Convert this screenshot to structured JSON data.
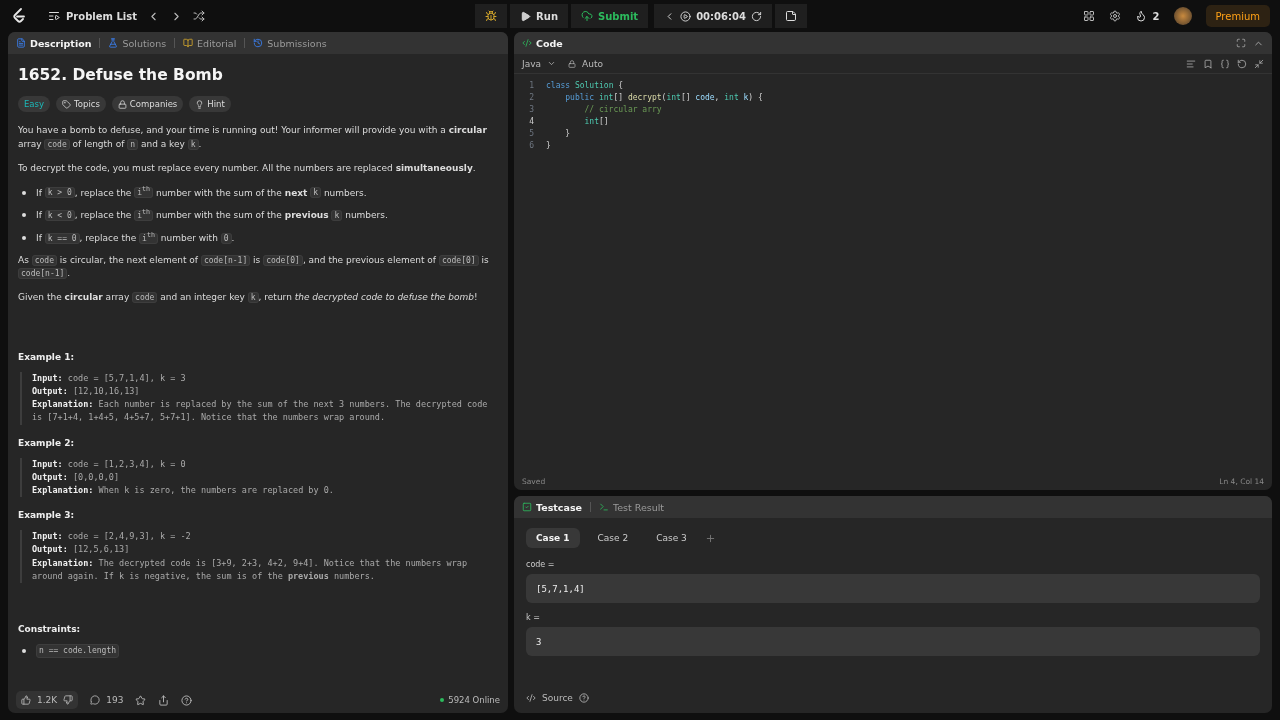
{
  "topbar": {
    "problem_list": "Problem List",
    "run": "Run",
    "submit": "Submit",
    "timer": "00:06:04",
    "streak": "2",
    "premium": "Premium"
  },
  "left_tabs": [
    {
      "label": "Description",
      "selected": true
    },
    {
      "label": "Solutions",
      "selected": false
    },
    {
      "label": "Editorial",
      "selected": false
    },
    {
      "label": "Submissions",
      "selected": false
    }
  ],
  "title": "1652. Defuse the Bomb",
  "tags": [
    {
      "kind": "difficulty",
      "label": "Easy"
    },
    {
      "kind": "topics",
      "label": "Topics"
    },
    {
      "kind": "companies",
      "label": "Companies"
    },
    {
      "kind": "hint",
      "label": "Hint"
    }
  ],
  "description": [
    {
      "kind": "para",
      "segments": [
        {
          "kind": "text",
          "text": "You have a bomb to defuse, and your time is running out! Your informer will provide you with a **circular** array "
        },
        {
          "kind": "code",
          "text": "code"
        },
        {
          "kind": "text",
          "text": " of length of "
        },
        {
          "kind": "code",
          "text": "n"
        },
        {
          "kind": "text",
          "text": " and a key "
        },
        {
          "kind": "code",
          "text": "k"
        },
        {
          "kind": "text",
          "text": "."
        }
      ]
    },
    {
      "kind": "para",
      "segments": [
        {
          "kind": "text",
          "text": "To decrypt the code, you must replace every number. All the numbers are replaced **simultaneously**."
        }
      ]
    },
    {
      "kind": "bullet",
      "segments": [
        {
          "kind": "text",
          "text": "If "
        },
        {
          "kind": "code",
          "text": "k > 0"
        },
        {
          "kind": "text",
          "text": ", replace the "
        },
        {
          "kind": "code",
          "text": "i$^{th}$"
        },
        {
          "kind": "text",
          "text": " number with the sum of the **next** "
        },
        {
          "kind": "code",
          "text": "k"
        },
        {
          "kind": "text",
          "text": " numbers."
        }
      ]
    },
    {
      "kind": "bullet",
      "segments": [
        {
          "kind": "text",
          "text": "If "
        },
        {
          "kind": "code",
          "text": "k < 0"
        },
        {
          "kind": "text",
          "text": ", replace the "
        },
        {
          "kind": "code",
          "text": "i$^{th}$"
        },
        {
          "kind": "text",
          "text": " number with the sum of the **previous** "
        },
        {
          "kind": "code",
          "text": "k"
        },
        {
          "kind": "text",
          "text": " numbers."
        }
      ]
    },
    {
      "kind": "bullet",
      "segments": [
        {
          "kind": "text",
          "text": "If "
        },
        {
          "kind": "code",
          "text": "k == 0"
        },
        {
          "kind": "text",
          "text": ", replace the "
        },
        {
          "kind": "code",
          "text": "i$^{th}$"
        },
        {
          "kind": "text",
          "text": " number with "
        },
        {
          "kind": "code",
          "text": "0"
        },
        {
          "kind": "text",
          "text": "."
        }
      ]
    },
    {
      "kind": "para",
      "segments": [
        {
          "kind": "text",
          "text": "As "
        },
        {
          "kind": "code",
          "text": "code"
        },
        {
          "kind": "text",
          "text": " is circular, the next element of "
        },
        {
          "kind": "code",
          "text": "code[n-1]"
        },
        {
          "kind": "text",
          "text": " is "
        },
        {
          "kind": "code",
          "text": "code[0]"
        },
        {
          "kind": "text",
          "text": ", and the previous element of "
        },
        {
          "kind": "code",
          "text": "code[0]"
        },
        {
          "kind": "text",
          "text": " is "
        },
        {
          "kind": "code",
          "text": "code[n-1]"
        },
        {
          "kind": "text",
          "text": "."
        }
      ]
    },
    {
      "kind": "para",
      "segments": [
        {
          "kind": "text",
          "text": "Given the **circular** array "
        },
        {
          "kind": "code",
          "text": "code"
        },
        {
          "kind": "text",
          "text": " and an integer key "
        },
        {
          "kind": "code",
          "text": "k"
        },
        {
          "kind": "text",
          "text": ", return *the decrypted code to defuse the bomb*!"
        }
      ]
    }
  ],
  "examples": [
    {
      "title": "Example 1:",
      "lines": [
        {
          "label": "Input:",
          "text": "code = [5,7,1,4], k = 3"
        },
        {
          "label": "Output:",
          "text": "[12,10,16,13]"
        },
        {
          "label": "Explanation:",
          "text": "Each number is replaced by the sum of the next 3 numbers. The decrypted code is [7+1+4, 1+4+5, 4+5+7, 5+7+1]. Notice that the numbers wrap around."
        }
      ]
    },
    {
      "title": "Example 2:",
      "lines": [
        {
          "label": "Input:",
          "text": "code = [1,2,3,4], k = 0"
        },
        {
          "label": "Output:",
          "text": "[0,0,0,0]"
        },
        {
          "label": "Explanation:",
          "text": "When k is zero, the numbers are replaced by 0."
        }
      ]
    },
    {
      "title": "Example 3:",
      "lines": [
        {
          "label": "Input:",
          "text": "code = [2,4,9,3], k = -2"
        },
        {
          "label": "Output:",
          "text": "[12,5,6,13]"
        },
        {
          "label": "Explanation:",
          "text": "The decrypted code is [3+9, 2+3, 4+2, 9+4]. Notice that the numbers wrap around again. If k is negative, the sum is of the **previous** numbers."
        }
      ]
    }
  ],
  "constraints": {
    "title": "Constraints:",
    "items": [
      "n == code.length"
    ]
  },
  "footer": {
    "likes": "1.2K",
    "comments": "193",
    "online": "5924 Online"
  },
  "code_panel": {
    "title": "Code",
    "language": "Java",
    "mode": "Auto",
    "status": "Saved",
    "position": "Ln 4, Col 14",
    "lines": [
      {
        "number": "1",
        "tokens": [
          {
            "kind": "keyword",
            "text": "class"
          },
          {
            "kind": "type",
            "text": " Solution"
          },
          {
            "kind": "plain",
            "text": " {"
          }
        ]
      },
      {
        "number": "2",
        "tokens": [
          {
            "kind": "keyword",
            "text": "    public"
          },
          {
            "kind": "type",
            "text": " int"
          },
          {
            "kind": "plain",
            "text": "[] "
          },
          {
            "kind": "func",
            "text": "decrypt"
          },
          {
            "kind": "plain",
            "text": "("
          },
          {
            "kind": "type",
            "text": "int"
          },
          {
            "kind": "plain",
            "text": "[] "
          },
          {
            "kind": "var",
            "text": "code"
          },
          {
            "kind": "plain",
            "text": ", "
          },
          {
            "kind": "type",
            "text": "int"
          },
          {
            "kind": "var",
            "text": " k"
          },
          {
            "kind": "plain",
            "text": ") {"
          }
        ]
      },
      {
        "number": "3",
        "tokens": [
          {
            "kind": "comment",
            "text": "        // circular arry"
          }
        ]
      },
      {
        "number": "4",
        "tokens": [
          {
            "kind": "type",
            "text": "        int"
          },
          {
            "kind": "plain",
            "text": "[]"
          }
        ]
      },
      {
        "number": "5",
        "tokens": [
          {
            "kind": "plain",
            "text": "    }"
          }
        ]
      },
      {
        "number": "6",
        "tokens": [
          {
            "kind": "plain",
            "text": "}"
          }
        ]
      }
    ]
  },
  "test_tabs": [
    {
      "label": "Testcase",
      "selected": true
    },
    {
      "label": "Test Result",
      "selected": false
    }
  ],
  "cases": [
    {
      "label": "Case 1",
      "selected": true
    },
    {
      "label": "Case 2",
      "selected": false
    },
    {
      "label": "Case 3",
      "selected": false
    }
  ],
  "inputs": [
    {
      "label": "code =",
      "value": "[5,7,1,4]"
    },
    {
      "label": "k =",
      "value": "3"
    }
  ],
  "source": "Source"
}
